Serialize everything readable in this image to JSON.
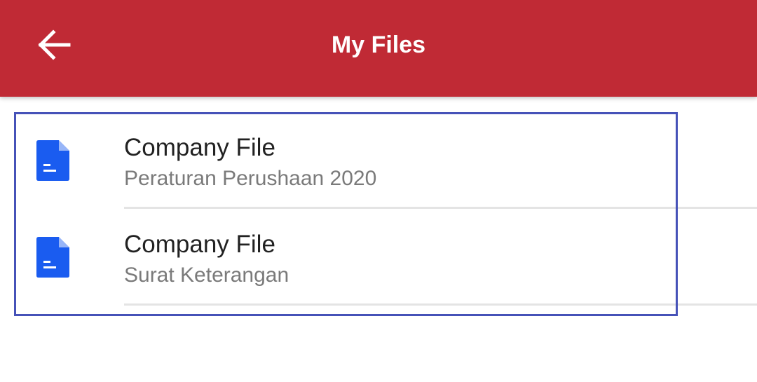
{
  "app_bar": {
    "title": "My Files",
    "back_icon": "arrow-left-icon",
    "background_color": "#c02a35"
  },
  "files": [
    {
      "icon": "document-icon",
      "title": "Company File",
      "subtitle": "Peraturan Perushaan 2020"
    },
    {
      "icon": "document-icon",
      "title": "Company File",
      "subtitle": "Surat Keterangan"
    }
  ],
  "colors": {
    "icon_blue": "#1a5cf0",
    "selection_border": "#4652b8"
  }
}
